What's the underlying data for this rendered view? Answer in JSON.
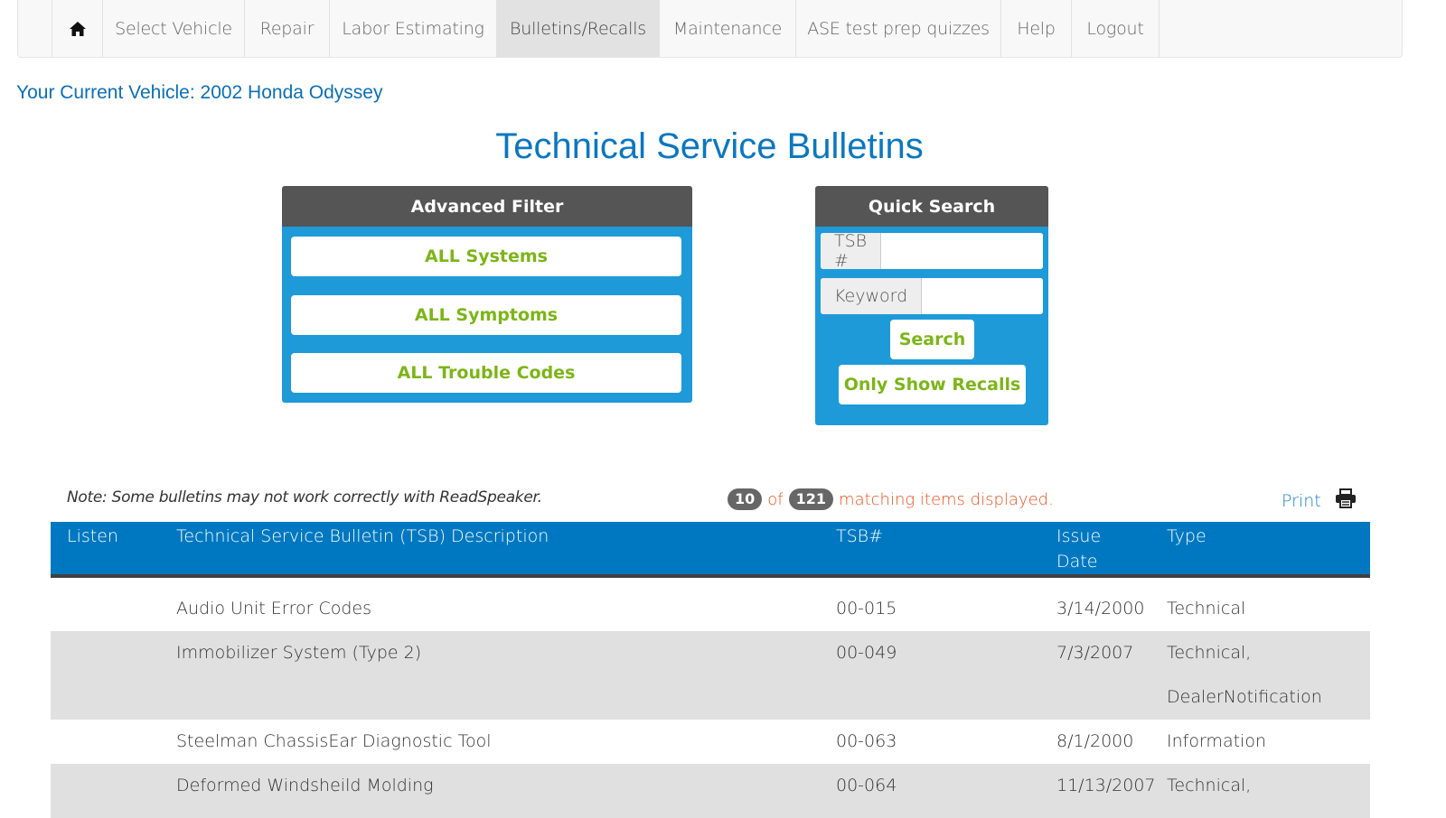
{
  "nav": {
    "home_icon": "home-icon",
    "items": [
      {
        "label": "Select Vehicle"
      },
      {
        "label": "Repair"
      },
      {
        "label": "Labor Estimating"
      },
      {
        "label": "Bulletins/Recalls"
      },
      {
        "label": "Maintenance"
      },
      {
        "label": "ASE test prep quizzes"
      },
      {
        "label": "Help"
      },
      {
        "label": "Logout"
      }
    ]
  },
  "current_vehicle": "Your Current Vehicle: 2002 Honda Odyssey",
  "page_title": "Technical Service Bulletins",
  "advanced_filter": {
    "title": "Advanced Filter",
    "buttons": [
      "ALL Systems",
      "ALL Symptoms",
      "ALL Trouble Codes"
    ]
  },
  "quick_search": {
    "title": "Quick Search",
    "tsb_label": "TSB #",
    "tsb_value": "",
    "keyword_label": "Keyword",
    "keyword_value": "",
    "search_label": "Search",
    "recalls_label": "Only Show Recalls"
  },
  "note": "Note: Some bulletins may not work correctly with ReadSpeaker.",
  "results": {
    "shown": "10",
    "of_text": "of",
    "total": "121",
    "suffix": "matching items displayed."
  },
  "print": {
    "label": "Print",
    "icon": "printer-icon"
  },
  "table": {
    "headers": {
      "listen": "Listen",
      "description": "Technical Service Bulletin (TSB) Description",
      "tsb": "TSB#",
      "issue_line1": "Issue",
      "issue_line2": "Date",
      "type": "Type"
    },
    "rows": [
      {
        "description": "Audio Unit Error Codes",
        "tsb": "00-015",
        "date": "3/14/2000",
        "type1": "Technical",
        "type2": ""
      },
      {
        "description": "Immobilizer System (Type 2)",
        "tsb": "00-049",
        "date": "7/3/2007",
        "type1": "Technical,",
        "type2": "DealerNotification"
      },
      {
        "description": "Steelman ChassisEar Diagnostic Tool",
        "tsb": "00-063",
        "date": "8/1/2000",
        "type1": "Information",
        "type2": ""
      },
      {
        "description": "Deformed Windsheild Molding",
        "tsb": "00-064",
        "date": "11/13/2007",
        "type1": "Technical,",
        "type2": ""
      }
    ]
  },
  "colors": {
    "nav_bg": "#f8f8f8",
    "accent_blue": "#0b77c0",
    "panel_blue": "#1e9ad9",
    "panel_header": "#555555",
    "button_green": "#7cb518",
    "count_orange": "#e8531f",
    "table_header": "#0078c1",
    "row_alt": "#e0e0e0"
  }
}
